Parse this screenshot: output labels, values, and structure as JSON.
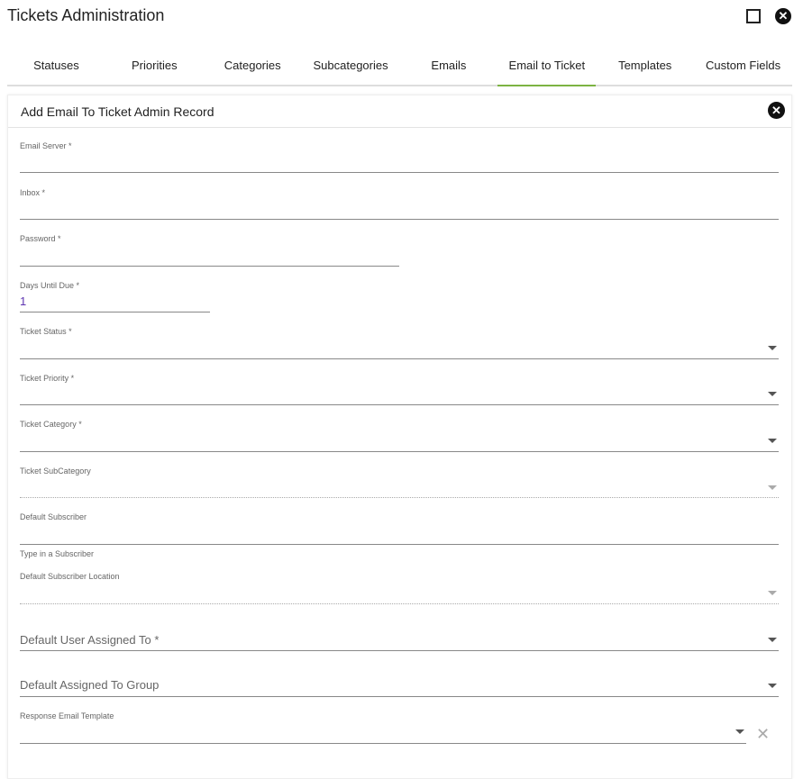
{
  "window": {
    "title": "Tickets Administration"
  },
  "tabs": [
    {
      "label": "Statuses"
    },
    {
      "label": "Priorities"
    },
    {
      "label": "Categories"
    },
    {
      "label": "Subcategories"
    },
    {
      "label": "Emails"
    },
    {
      "label": "Email to Ticket",
      "active": true
    },
    {
      "label": "Templates"
    },
    {
      "label": "Custom Fields"
    }
  ],
  "panel": {
    "title": "Add Email To Ticket Admin Record"
  },
  "fields": {
    "email_server": {
      "label": "Email Server *",
      "value": ""
    },
    "inbox": {
      "label": "Inbox *",
      "value": ""
    },
    "password": {
      "label": "Password *",
      "value": ""
    },
    "days_until_due": {
      "label": "Days Until Due *",
      "value": "1"
    },
    "ticket_status": {
      "label": "Ticket Status *"
    },
    "ticket_priority": {
      "label": "Ticket Priority *"
    },
    "ticket_category": {
      "label": "Ticket Category *"
    },
    "ticket_subcategory": {
      "label": "Ticket SubCategory"
    },
    "default_subscriber": {
      "label": "Default Subscriber",
      "hint": "Type in a Subscriber"
    },
    "default_subscriber_location": {
      "label": "Default Subscriber Location"
    },
    "default_user_assigned": {
      "placeholder": "Default User Assigned To *"
    },
    "default_group": {
      "placeholder": "Default Assigned To Group"
    },
    "response_template": {
      "label": "Response Email Template"
    }
  },
  "colors": {
    "accent": "#7cb342",
    "value": "#5e35b1"
  }
}
